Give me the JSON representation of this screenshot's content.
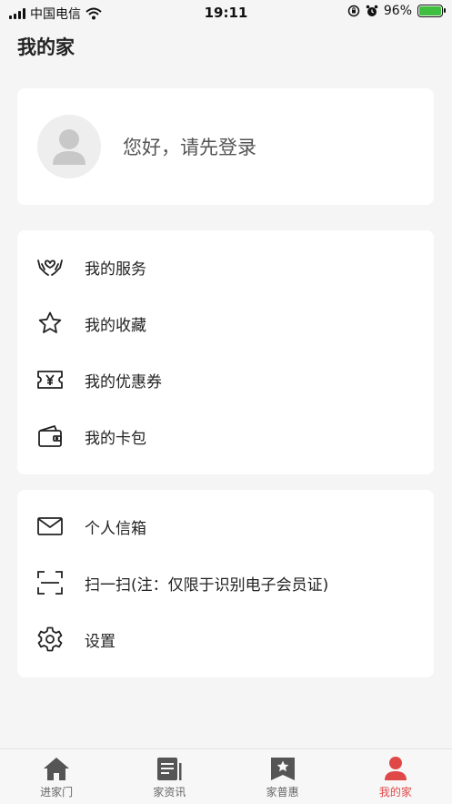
{
  "status_bar": {
    "carrier": "中国电信",
    "time": "19:11",
    "battery": "96%"
  },
  "page": {
    "title": "我的家"
  },
  "login": {
    "prompt": "您好，请先登录"
  },
  "menu_group_1": [
    {
      "label": "我的服务",
      "icon": "service-hands-icon"
    },
    {
      "label": "我的收藏",
      "icon": "star-icon"
    },
    {
      "label": "我的优惠券",
      "icon": "coupon-icon"
    },
    {
      "label": "我的卡包",
      "icon": "wallet-icon"
    }
  ],
  "menu_group_2": [
    {
      "label": "个人信箱",
      "icon": "mail-icon"
    },
    {
      "label": "扫一扫(注：仅限于识别电子会员证)",
      "icon": "scan-icon"
    },
    {
      "label": "设置",
      "icon": "gear-icon"
    }
  ],
  "tabs": [
    {
      "label": "进家门",
      "icon": "home-icon",
      "active": false
    },
    {
      "label": "家资讯",
      "icon": "news-icon",
      "active": false
    },
    {
      "label": "家普惠",
      "icon": "bookmark-star-icon",
      "active": false
    },
    {
      "label": "我的家",
      "icon": "person-icon",
      "active": true
    }
  ],
  "colors": {
    "accent": "#e04848",
    "background": "#f5f5f5",
    "card": "#ffffff"
  }
}
